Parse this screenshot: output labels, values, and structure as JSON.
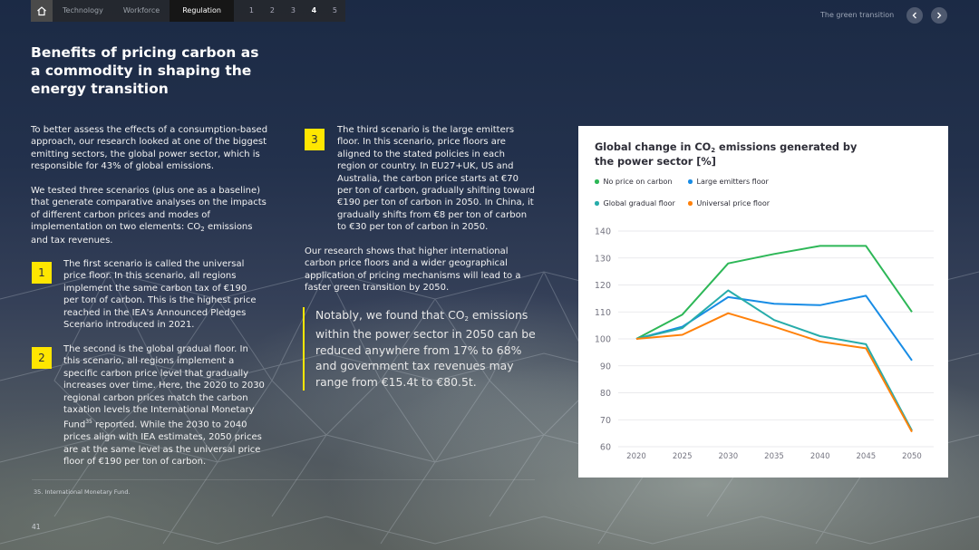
{
  "nav": {
    "home_icon": "home-icon",
    "tabs": [
      {
        "label": "Technology",
        "active": false
      },
      {
        "label": "Workforce",
        "active": false
      },
      {
        "label": "Regulation",
        "active": true
      }
    ],
    "pages": [
      "1",
      "2",
      "3",
      "4",
      "5"
    ],
    "active_page": "4",
    "section_label": "The green transition",
    "prev_icon": "chevron-left-icon",
    "next_icon": "chevron-right-icon"
  },
  "heading": "Benefits of pricing carbon as a commodity in shaping the energy transition",
  "intro": {
    "p1": "To better assess the effects of a consumption-based approach, our research looked at one of the biggest emitting sectors, the global power sector, which is responsible for 43% of global emissions.",
    "p2_before": "We tested three scenarios (plus one as a baseline) that generate comparative analyses on the impacts of different carbon prices and modes of implementation on two elements: CO",
    "p2_sub": "2",
    "p2_after": " emissions and tax revenues."
  },
  "scenarios": [
    {
      "number": "1",
      "text": "The first scenario is called the universal price floor. In this scenario, all regions implement the same carbon tax of €190 per ton of carbon. This is the highest price reached in the IEA's Announced Pledges Scenario introduced in 2021."
    },
    {
      "number": "2",
      "text_before": "The second is the global gradual floor. In this scenario, all regions implement a specific carbon price level that gradually increases over time. Here, the 2020 to 2030 regional carbon prices match the carbon taxation levels the International Monetary Fund",
      "sup": "35",
      "text_after": " reported. While the 2030 to 2040 prices align with IEA estimates, 2050 prices are at the same level as the universal price floor of €190 per ton of carbon."
    },
    {
      "number": "3",
      "text": "The third scenario is the large emitters floor. In this scenario, price floors are aligned to the stated policies in each region or country. In EU27+UK, US and Australia, the carbon price starts at €70 per ton of carbon, gradually shifting toward €190 per ton of carbon in 2050. In China, it gradually shifts from €8 per ton of carbon to €30 per ton of carbon in 2050."
    }
  ],
  "research_text": "Our research shows that higher international carbon price floors and a wider geographical application of pricing mechanisms will lead to a faster green transition by 2050.",
  "quote": {
    "before": "Notably, we found that CO",
    "sub": "2",
    "after": " emissions within the power sector in 2050 can be reduced anywhere from 17% to 68% and government tax revenues may range from €15.4t to €80.5t."
  },
  "footnote": "35. International Monetary Fund.",
  "page_number": "41",
  "colors": {
    "accent_yellow": "#ffe600",
    "no_price": "#2db757",
    "large_emitters": "#188ce5",
    "global_gradual": "#27acaa",
    "universal": "#ff810a"
  },
  "chart_data": {
    "type": "line",
    "title_before": "Global change in CO",
    "title_sub": "2",
    "title_after": " emissions generated by the power sector [%]",
    "x": [
      2020,
      2025,
      2030,
      2035,
      2040,
      2045,
      2050
    ],
    "ylim": [
      60,
      140
    ],
    "yticks": [
      60,
      70,
      80,
      90,
      100,
      110,
      120,
      130,
      140
    ],
    "grid": true,
    "legend_position": "top-left",
    "series": [
      {
        "name": "No price on carbon",
        "color": "#2db757",
        "values": [
          100,
          109,
          128,
          131.5,
          134.5,
          134.5,
          110
        ]
      },
      {
        "name": "Large emitters floor",
        "color": "#188ce5",
        "values": [
          100,
          104.5,
          115.5,
          113,
          112.5,
          116,
          92
        ]
      },
      {
        "name": "Global gradual floor",
        "color": "#27acaa",
        "values": [
          100,
          104,
          118,
          107,
          101,
          98,
          66
        ]
      },
      {
        "name": "Universal price floor",
        "color": "#ff810a",
        "values": [
          100,
          101.5,
          109.5,
          104.5,
          99,
          96.5,
          65.5
        ]
      }
    ]
  }
}
